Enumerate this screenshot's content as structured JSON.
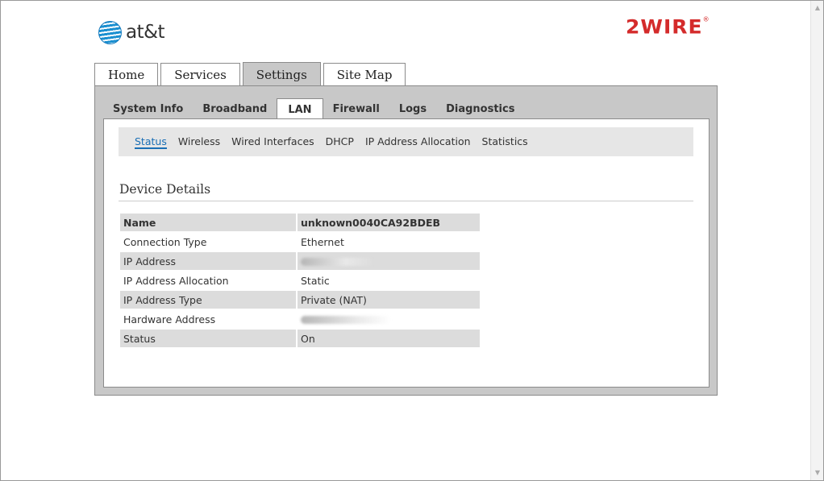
{
  "logos": {
    "att_text": "at&t",
    "wire_text": "2WIRE",
    "wire_mark": "®"
  },
  "top_tabs": [
    {
      "label": "Home",
      "active": false
    },
    {
      "label": "Services",
      "active": false
    },
    {
      "label": "Settings",
      "active": true
    },
    {
      "label": "Site Map",
      "active": false
    }
  ],
  "sub_tabs": [
    {
      "label": "System Info",
      "active": false
    },
    {
      "label": "Broadband",
      "active": false
    },
    {
      "label": "LAN",
      "active": true
    },
    {
      "label": "Firewall",
      "active": false
    },
    {
      "label": "Logs",
      "active": false
    },
    {
      "label": "Diagnostics",
      "active": false
    }
  ],
  "lan_nav": [
    {
      "label": "Status",
      "active": true
    },
    {
      "label": "Wireless",
      "active": false
    },
    {
      "label": "Wired Interfaces",
      "active": false
    },
    {
      "label": "DHCP",
      "active": false
    },
    {
      "label": "IP Address Allocation",
      "active": false
    },
    {
      "label": "Statistics",
      "active": false
    }
  ],
  "device_details": {
    "title": "Device Details",
    "rows": [
      {
        "key": "Name",
        "value": "unknown0040CA92BDEB"
      },
      {
        "key": "Connection Type",
        "value": "Ethernet"
      },
      {
        "key": "IP Address",
        "value": "",
        "redacted": true
      },
      {
        "key": "IP Address Allocation",
        "value": "Static"
      },
      {
        "key": "IP Address Type",
        "value": "Private (NAT)"
      },
      {
        "key": "Hardware Address",
        "value": "",
        "redacted": true
      },
      {
        "key": "Status",
        "value": "On"
      }
    ]
  },
  "colors": {
    "panel": "#c8c8c8",
    "link_active": "#1a6fb5",
    "brand_red": "#d42b2b",
    "att_blue": "#1a8fd0"
  }
}
